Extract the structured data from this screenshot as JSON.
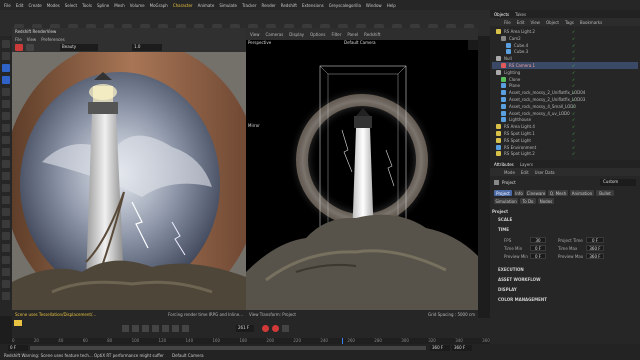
{
  "menu": [
    "File",
    "Edit",
    "Create",
    "Modes",
    "Select",
    "Tools",
    "Spline",
    "Mesh",
    "Volume",
    "MoGraph",
    "Character",
    "Animate",
    "Simulate",
    "Tracker",
    "Render",
    "Redshift",
    "Extensions",
    "Greyscalegorilla",
    "Window",
    "Help"
  ],
  "render_view": {
    "title": "Redshift RenderView",
    "menu": [
      "File",
      "View",
      "Preferences"
    ],
    "mode": "Beauty",
    "zoom": "1.0",
    "status_left": "Scene uses Tessellation/Displacement/...",
    "status_right": "Forcing render time IRPG and Inline..."
  },
  "viewport": {
    "menu": [
      "View",
      "Cameras",
      "Display",
      "Options",
      "Filter",
      "Panel",
      "Redshift"
    ],
    "title": "Perspective",
    "camera": "Default Camera",
    "label_mirror": "Mirror",
    "status_left": "View Transform: Project",
    "status_right": "Grid Spacing : 5000 cm"
  },
  "objects": {
    "tabs": [
      "Objects",
      "Takes"
    ],
    "menu": [
      "File",
      "Edit",
      "View",
      "Object",
      "Tags",
      "Bookmarks"
    ],
    "rows": [
      {
        "name": "RS Area Light.2",
        "indent": 0,
        "color": "#d9c24a"
      },
      {
        "name": "Cam2",
        "indent": 1,
        "color": "#888888"
      },
      {
        "name": "Cube.4",
        "indent": 2,
        "color": "#5aa0e0"
      },
      {
        "name": "Cube.3",
        "indent": 2,
        "color": "#5aa0e0"
      },
      {
        "name": "Null",
        "indent": 0,
        "color": "#aaaaaa"
      },
      {
        "name": "RS Camera.1",
        "indent": 1,
        "color": "#e05a5a",
        "selected": true
      },
      {
        "name": "Lighting",
        "indent": 0,
        "color": "#aaaaaa"
      },
      {
        "name": "Clone",
        "indent": 1,
        "color": "#5ac05a"
      },
      {
        "name": "Plane",
        "indent": 1,
        "color": "#5aa0e0"
      },
      {
        "name": "Asset_rock_mossy_2_Uniflatfix_LOD04",
        "indent": 1,
        "color": "#5aa0e0"
      },
      {
        "name": "Asset_rock_mossy_2_Uniflatfix_LOD03",
        "indent": 1,
        "color": "#5aa0e0"
      },
      {
        "name": "Asset_rock_mossy_4_Small_LOD0",
        "indent": 1,
        "color": "#5aa0e0"
      },
      {
        "name": "Asset_rock_mossy_4_uv_LOD0",
        "indent": 1,
        "color": "#5aa0e0"
      },
      {
        "name": "Lighthouse",
        "indent": 1,
        "color": "#5aa0e0"
      },
      {
        "name": "RS Area Light.4",
        "indent": 0,
        "color": "#d9c24a"
      },
      {
        "name": "RS Spot Light.1",
        "indent": 0,
        "color": "#d9c24a"
      },
      {
        "name": "RS Spot Light",
        "indent": 0,
        "color": "#d9c24a"
      },
      {
        "name": "RS Environment",
        "indent": 0,
        "color": "#5aa0e0"
      },
      {
        "name": "RS Spot Light.2",
        "indent": 0,
        "color": "#d9c24a"
      }
    ]
  },
  "attributes": {
    "tabs": [
      "Attributes",
      "Layers"
    ],
    "menu": [
      "Mode",
      "Edit",
      "User Data"
    ],
    "mode_label": "Project",
    "preset": "Custom",
    "buttons": [
      "Project",
      "Info",
      "Cineware",
      "Q. Mesh",
      "Animation",
      "Bullet",
      "Simulation",
      "To Do",
      "Nodes"
    ],
    "section": "Project",
    "scale_label": "SCALE",
    "time_label": "TIME",
    "fps_label": "FPS",
    "fps": "30",
    "proj_time_label": "Project Time",
    "proj_time": "0 F",
    "time_min_label": "Time Min",
    "time_min": "0 F",
    "time_max_label": "Time Max",
    "time_max": "360 F",
    "prev_min_label": "Preview Min",
    "prev_min": "0 F",
    "prev_max_label": "Preview Max",
    "prev_max": "360 F",
    "collapsed": [
      "EXECUTION",
      "ASSET WORKFLOW",
      "DISPLAY",
      "COLOR MANAGEMENT"
    ]
  },
  "timeline": {
    "start": "0 F",
    "frame": "261 F",
    "end_a": "360 F",
    "end_b": "360 F",
    "ticks": [
      "0",
      "20",
      "40",
      "60",
      "80",
      "100",
      "120",
      "140",
      "160",
      "180",
      "200",
      "220",
      "240",
      "260",
      "280",
      "300",
      "320",
      "340",
      "360"
    ]
  },
  "statusbar": {
    "message": "Redshift Warning: Scene uses feature tech... OptiX RT performance might suffer",
    "camera": "Default Camera"
  }
}
